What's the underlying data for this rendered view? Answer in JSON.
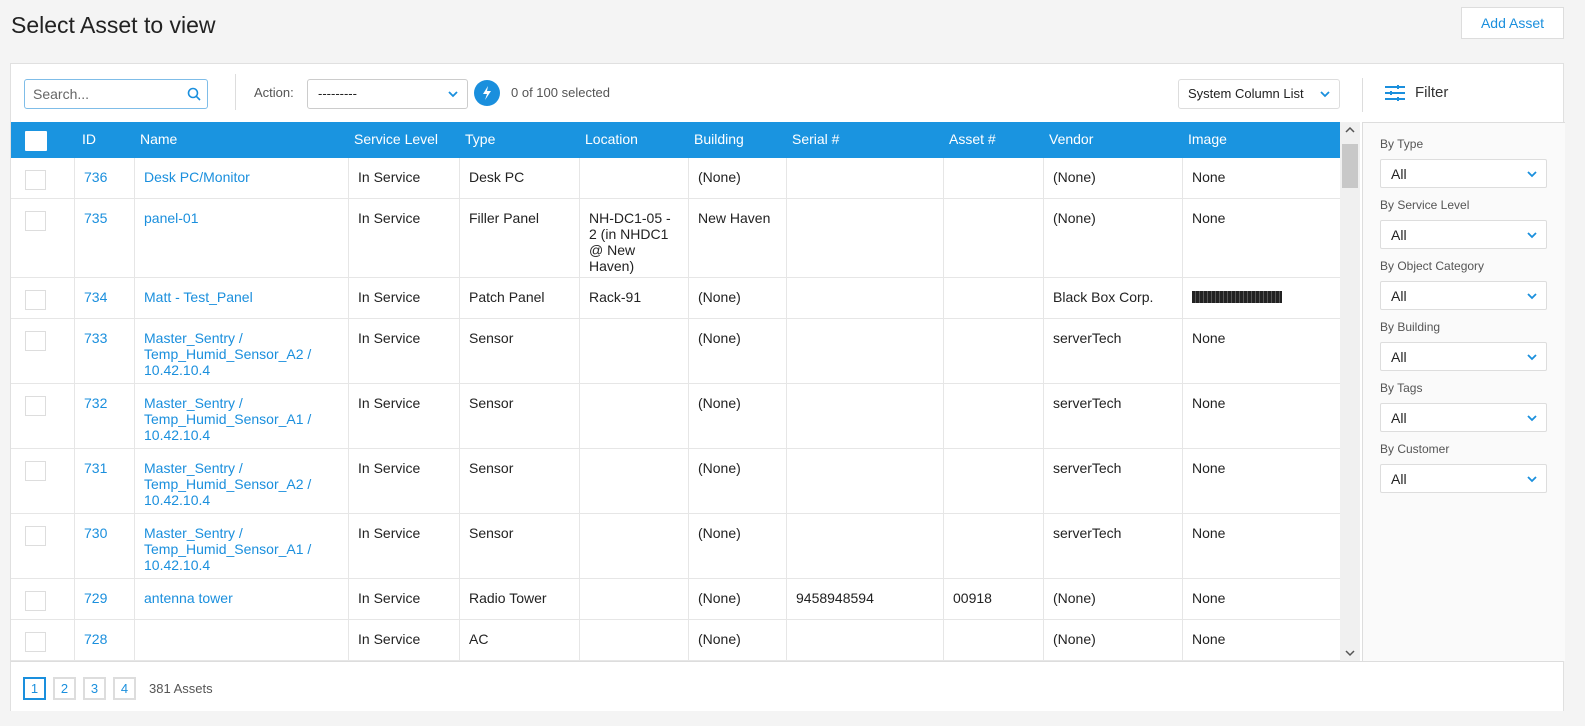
{
  "page": {
    "title": "Select Asset to view",
    "add_label": "Add Asset"
  },
  "toolbar": {
    "search_placeholder": "Search...",
    "action_label": "Action:",
    "action_value": "---------",
    "selected": "0 of 100 selected",
    "column_list": "System Column List",
    "filter_label": "Filter"
  },
  "columns": [
    "ID",
    "Name",
    "Service Level",
    "Type",
    "Location",
    "Building",
    "Serial #",
    "Asset #",
    "Vendor",
    "Image"
  ],
  "rows": [
    {
      "id": "736",
      "name": "Desk PC/Monitor",
      "service": "In Service",
      "type": "Desk PC",
      "location": "",
      "building": "(None)",
      "serial": "",
      "asset": "",
      "vendor": "(None)",
      "image": "None"
    },
    {
      "id": "735",
      "name": "panel-01",
      "service": "In Service",
      "type": "Filler Panel",
      "location": "NH-DC1-05 - 2 (in NHDC1 @ New Haven)",
      "building": "New Haven",
      "serial": "",
      "asset": "",
      "vendor": "(None)",
      "image": "None"
    },
    {
      "id": "734",
      "name": "Matt - Test_Panel",
      "service": "In Service",
      "type": "Patch Panel",
      "location": "Rack-91",
      "building": "(None)",
      "serial": "",
      "asset": "",
      "vendor": "Black Box Corp.",
      "image": ""
    },
    {
      "id": "733",
      "name": "Master_Sentry / Temp_Humid_Sensor_A2 / 10.42.10.4",
      "service": "In Service",
      "type": "Sensor",
      "location": "",
      "building": "(None)",
      "serial": "",
      "asset": "",
      "vendor": "serverTech",
      "image": "None"
    },
    {
      "id": "732",
      "name": "Master_Sentry / Temp_Humid_Sensor_A1 / 10.42.10.4",
      "service": "In Service",
      "type": "Sensor",
      "location": "",
      "building": "(None)",
      "serial": "",
      "asset": "",
      "vendor": "serverTech",
      "image": "None"
    },
    {
      "id": "731",
      "name": "Master_Sentry / Temp_Humid_Sensor_A2 / 10.42.10.4",
      "service": "In Service",
      "type": "Sensor",
      "location": "",
      "building": "(None)",
      "serial": "",
      "asset": "",
      "vendor": "serverTech",
      "image": "None"
    },
    {
      "id": "730",
      "name": "Master_Sentry / Temp_Humid_Sensor_A1 / 10.42.10.4",
      "service": "In Service",
      "type": "Sensor",
      "location": "",
      "building": "(None)",
      "serial": "",
      "asset": "",
      "vendor": "serverTech",
      "image": "None"
    },
    {
      "id": "729",
      "name": "antenna tower",
      "service": "In Service",
      "type": "Radio Tower",
      "location": "",
      "building": "(None)",
      "serial": "9458948594",
      "asset": "00918",
      "vendor": "(None)",
      "image": "None"
    },
    {
      "id": "728",
      "name": "",
      "service": "In Service",
      "type": "AC",
      "location": "",
      "building": "(None)",
      "serial": "",
      "asset": "",
      "vendor": "(None)",
      "image": "None"
    }
  ],
  "filters": [
    {
      "label": "By Type",
      "value": "All"
    },
    {
      "label": "By Service Level",
      "value": "All"
    },
    {
      "label": "By Object Category",
      "value": "All"
    },
    {
      "label": "By Building",
      "value": "All"
    },
    {
      "label": "By Tags",
      "value": "All"
    },
    {
      "label": "By Customer",
      "value": "All"
    }
  ],
  "pagination": {
    "pages": [
      "1",
      "2",
      "3",
      "4"
    ],
    "current": "1",
    "total": "381 Assets"
  },
  "colors": {
    "accent": "#1a94e0"
  }
}
